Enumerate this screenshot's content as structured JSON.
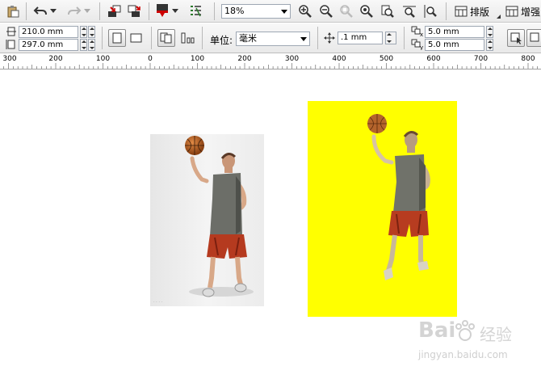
{
  "toolbar": {
    "zoom": "18%",
    "layout_label": "排版",
    "add_label": "增强"
  },
  "property_bar": {
    "page_width": "210.0 mm",
    "page_height": "297.0 mm",
    "unit_label": "单位:",
    "unit_value": "毫米",
    "nudge": ".1 mm",
    "dup_x": "5.0 mm",
    "dup_y": "5.0 mm"
  },
  "ruler": {
    "labels": [
      "300",
      "200",
      "100",
      "0",
      "100",
      "200",
      "300",
      "400",
      "500",
      "600",
      "700",
      "800"
    ]
  },
  "watermark": {
    "brand": "Bai",
    "brand2": "经验",
    "url": "jingyan.baidu.com"
  },
  "colors": {
    "accent_yellow": "#ffff00",
    "jersey": "#6c6e68",
    "shorts": "#b53a1f",
    "ball": "#c56a2a"
  }
}
